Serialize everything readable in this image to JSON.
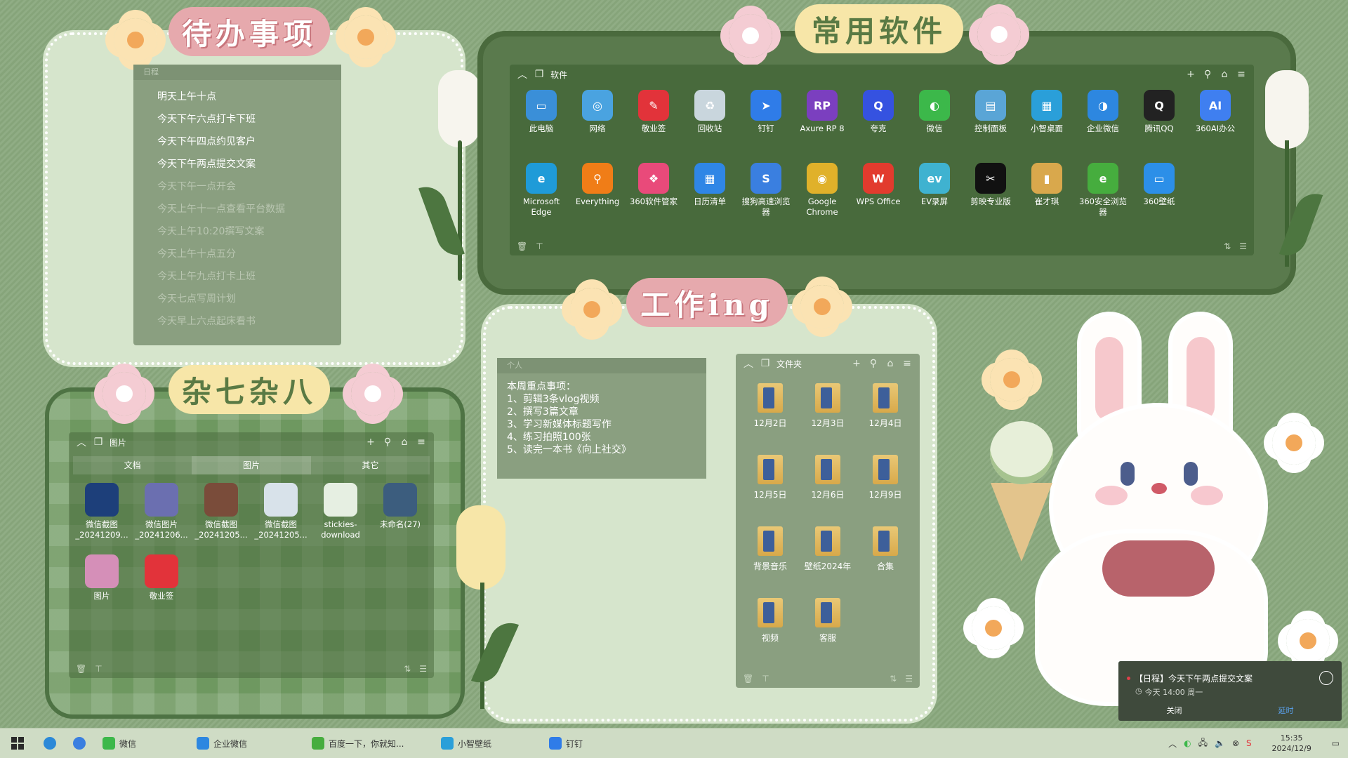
{
  "titles": {
    "todo": "待办事项",
    "apps": "常用软件",
    "work": "工作ing",
    "misc": "杂七杂八"
  },
  "todo": {
    "header": "日程",
    "items": [
      {
        "text": "明天上午十点",
        "done": false
      },
      {
        "text": "今天下午六点打卡下班",
        "done": false
      },
      {
        "text": "今天下午四点约见客户",
        "done": false
      },
      {
        "text": "今天下午两点提交文案",
        "done": false
      },
      {
        "text": "今天下午一点开会",
        "done": true
      },
      {
        "text": "今天上午十一点查看平台数据",
        "done": true
      },
      {
        "text": "今天上午10:20撰写文案",
        "done": true
      },
      {
        "text": "今天上午十点五分",
        "done": true
      },
      {
        "text": "今天上午九点打卡上班",
        "done": true
      },
      {
        "text": "今天七点写周计划",
        "done": true
      },
      {
        "text": "今天早上六点起床看书",
        "done": true
      }
    ]
  },
  "apps_fence": {
    "title": "软件",
    "row1": [
      {
        "label": "此电脑",
        "color": "#3a8fd8",
        "glyph": "▭"
      },
      {
        "label": "网络",
        "color": "#4aa3e0",
        "glyph": "◎"
      },
      {
        "label": "敬业签",
        "color": "#e2333a",
        "glyph": "✎"
      },
      {
        "label": "回收站",
        "color": "#c9d6dd",
        "glyph": "♻"
      },
      {
        "label": "钉钉",
        "color": "#2f7ce8",
        "glyph": "➤"
      },
      {
        "label": "Axure RP 8",
        "color": "#7b3fbf",
        "glyph": "RP"
      },
      {
        "label": "夸克",
        "color": "#3552e0",
        "glyph": "Q"
      },
      {
        "label": "微信",
        "color": "#3cb84a",
        "glyph": "◐"
      },
      {
        "label": "控制面板",
        "color": "#5aa5d6",
        "glyph": "▤"
      },
      {
        "label": "小智桌面",
        "color": "#2a9fd9",
        "glyph": "▦"
      },
      {
        "label": "企业微信",
        "color": "#2d87e0",
        "glyph": "◑"
      },
      {
        "label": "腾讯QQ",
        "color": "#222222",
        "glyph": "Q"
      },
      {
        "label": "360AI办公",
        "color": "#3f7ff0",
        "glyph": "AI"
      }
    ],
    "row2": [
      {
        "label": "Microsoft Edge",
        "color": "#1f9bd8",
        "glyph": "e"
      },
      {
        "label": "Everything",
        "color": "#f07d17",
        "glyph": "⚲"
      },
      {
        "label": "360软件管家",
        "color": "#e94a7a",
        "glyph": "❖"
      },
      {
        "label": "日历清单",
        "color": "#2f86e6",
        "glyph": "▦"
      },
      {
        "label": "搜狗高速浏览器",
        "color": "#3a7fe0",
        "glyph": "S"
      },
      {
        "label": "Google Chrome",
        "color": "#e0b12a",
        "glyph": "◉"
      },
      {
        "label": "WPS Office",
        "color": "#e23b2e",
        "glyph": "W"
      },
      {
        "label": "EV录屏",
        "color": "#3fb2d0",
        "glyph": "ev"
      },
      {
        "label": "剪映专业版",
        "color": "#111111",
        "glyph": "✂"
      },
      {
        "label": "崔才琪",
        "color": "#d9a84c",
        "glyph": "▮"
      },
      {
        "label": "360安全浏览器",
        "color": "#46ad3e",
        "glyph": "e"
      },
      {
        "label": "360壁纸",
        "color": "#2c8fe8",
        "glyph": "▭"
      }
    ]
  },
  "pics_fence": {
    "title": "图片",
    "tabs": [
      "文档",
      "图片",
      "其它"
    ],
    "active_tab": 1,
    "files": [
      {
        "label": "微信截图\n_20241209...",
        "color": "#1d3f7a"
      },
      {
        "label": "微信图片\n_20241206...",
        "color": "#6b6fb0"
      },
      {
        "label": "微信截图\n_20241205...",
        "color": "#7a4c3a"
      },
      {
        "label": "微信截图\n_20241205...",
        "color": "#d8e2ea"
      },
      {
        "label": "stickies-\ndownload",
        "color": "#e6efe2"
      },
      {
        "label": "未命名(27)",
        "color": "#3c5d7e"
      },
      {
        "label": "图片",
        "color": "#d58fb8"
      },
      {
        "label": "敬业签",
        "color": "#e2333a"
      }
    ]
  },
  "note": {
    "header": "个人",
    "body": "本周重点事项：\n1、剪辑3条vlog视频\n2、撰写3篇文章\n3、学习新媒体标题写作\n4、练习拍照100张\n5、读完一本书《向上社交》"
  },
  "folders_fence": {
    "title": "文件夹",
    "items": [
      "12月2日",
      "12月3日",
      "12月4日",
      "12月5日",
      "12月6日",
      "12月9日",
      "背景音乐",
      "壁纸2024年",
      "合集",
      "视频",
      "客服"
    ]
  },
  "toast": {
    "title": "【日程】今天下午两点提交文案",
    "time": "今天 14:00 周一",
    "close": "关闭",
    "delay": "延时"
  },
  "taskbar": {
    "items": [
      "微信",
      "企业微信",
      "百度一下，你就知...",
      "小智壁纸",
      "钉钉"
    ],
    "time": "15:35",
    "date": "2024/12/9"
  }
}
